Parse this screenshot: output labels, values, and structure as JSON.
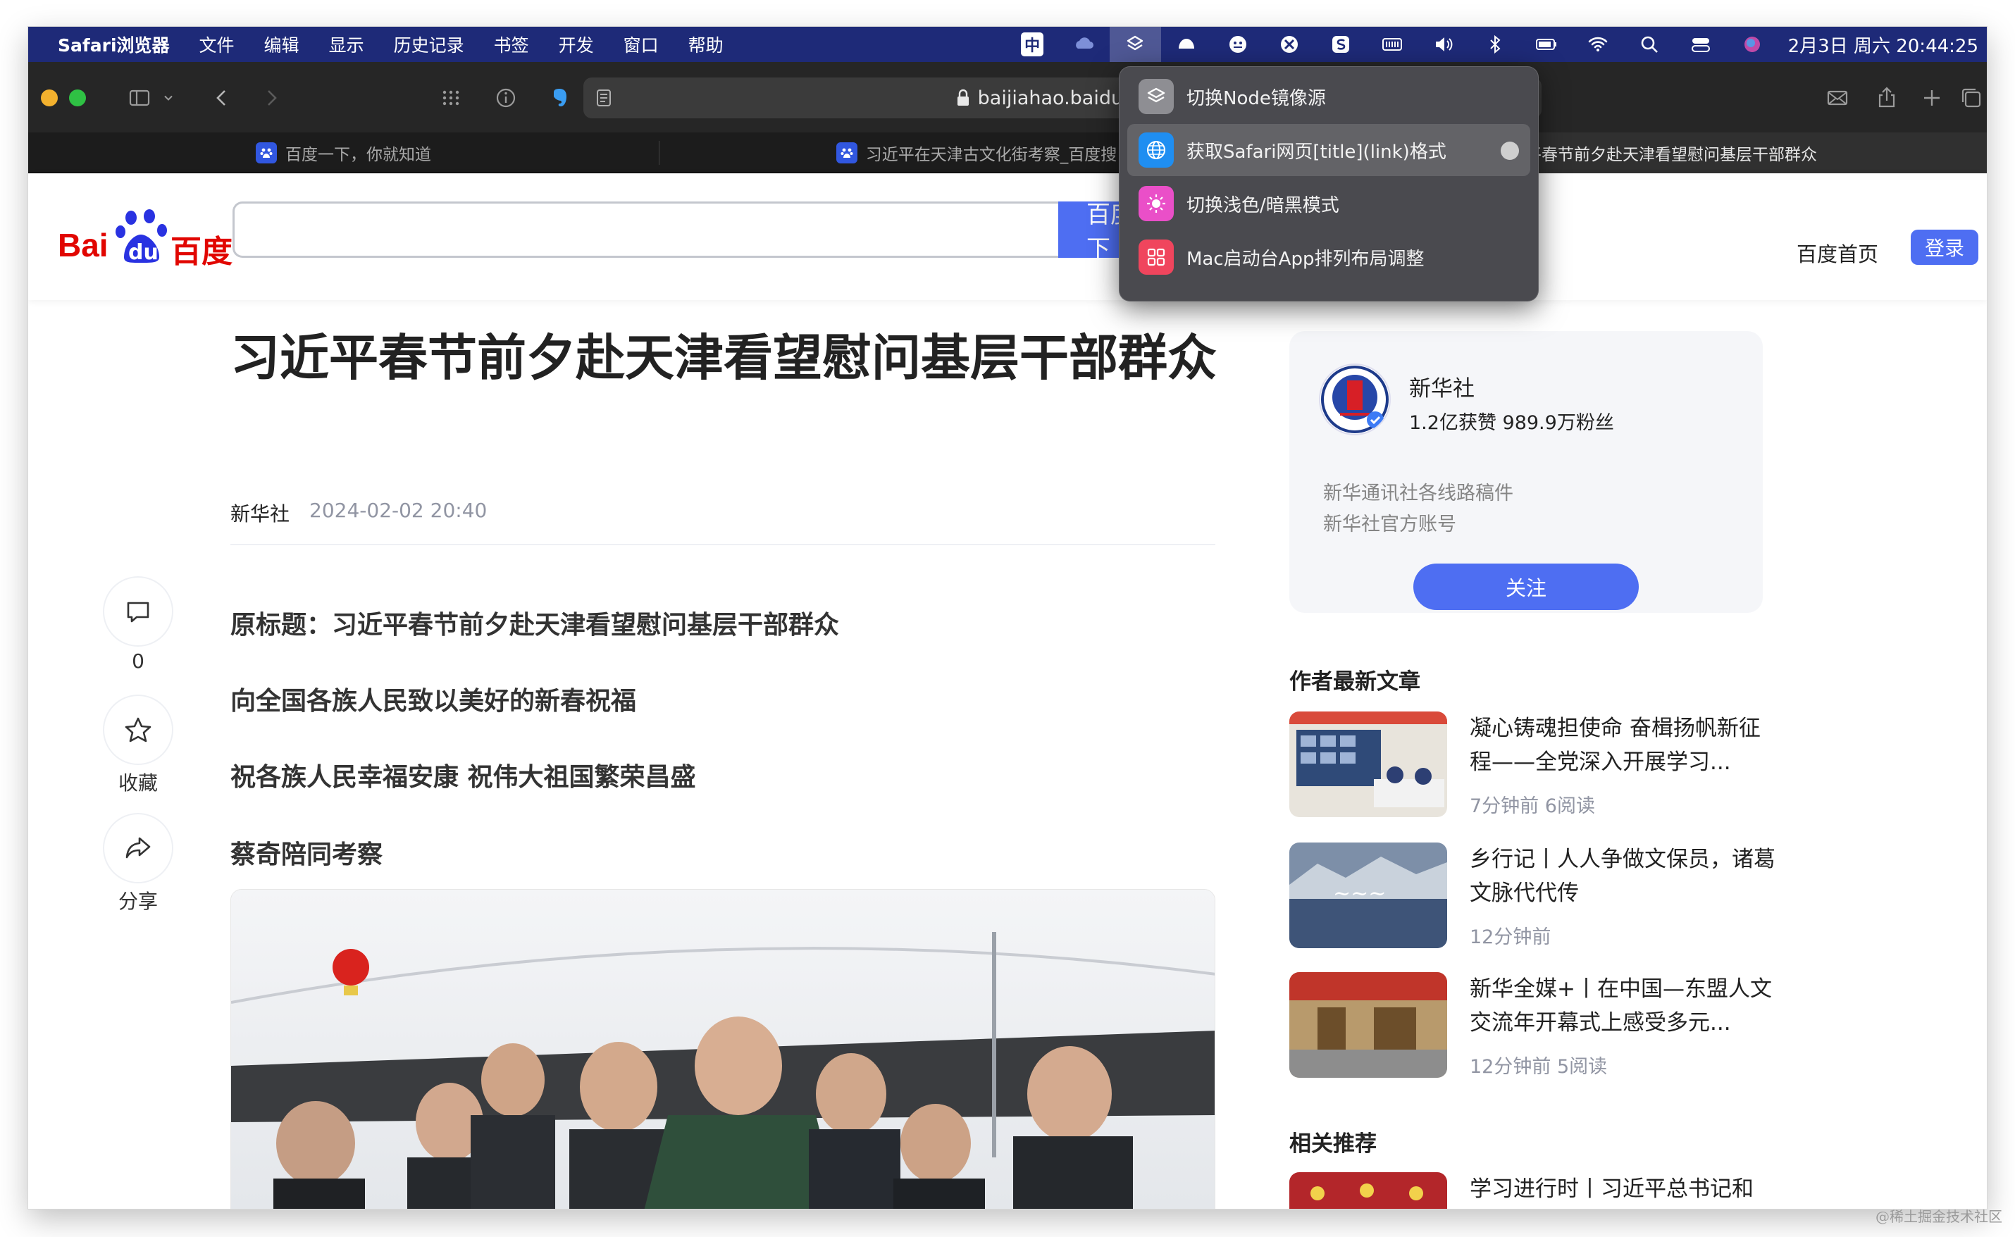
{
  "menubar": {
    "app": "Safari浏览器",
    "items": [
      "文件",
      "编辑",
      "显示",
      "历史记录",
      "书签",
      "开发",
      "窗口",
      "帮助"
    ],
    "status_icons": [
      "input-method-icon",
      "cloud-icon",
      "shortcuts-icon",
      "app-icon",
      "vpn-icon",
      "xcode-icon",
      "sogou-icon",
      "battery-meter-icon",
      "volume-icon",
      "bluetooth-icon",
      "battery-icon",
      "wifi-icon",
      "spotlight-icon",
      "control-center-icon",
      "siri-icon"
    ],
    "input_method": "中",
    "clock": "2月3日 周六  20:44:25"
  },
  "toolbar": {
    "url": "baijiahao.baidu.com"
  },
  "tabs": [
    {
      "title": "百度一下，你就知道",
      "active": false
    },
    {
      "title": "习近平在天津古文化街考察_百度搜",
      "active": false
    },
    {
      "title": "习近平春节前夕赴天津看望慰问基层干部群众",
      "active": true
    }
  ],
  "shortcuts_menu": {
    "items": [
      {
        "label": "切换Node镜像源",
        "icon": "layers-icon",
        "color": "#8e8e93"
      },
      {
        "label": "获取Safari网页[title](link)格式",
        "icon": "globe-icon",
        "color": "#1f8ef1"
      },
      {
        "label": "切换浅色/暗黑模式",
        "icon": "brightness-icon",
        "color": "#ea4fc8"
      },
      {
        "label": "Mac启动台App排列布局调整",
        "icon": "grid-icon",
        "color": "#f0455d"
      }
    ]
  },
  "baidu": {
    "logo_text_left": "Bai",
    "logo_text_mid": "du",
    "logo_text_right": "百度",
    "search_button": "百度一下",
    "home_link": "百度首页",
    "login_button": "登录"
  },
  "article": {
    "title": "习近平春节前夕赴天津看望慰问基层干部群众",
    "author": "新华社",
    "date": "2024-02-02 20:40",
    "paragraphs": [
      "原标题：习近平春节前夕赴天津看望慰问基层干部群众",
      "向全国各族人民致以美好的新春祝福",
      "祝各族人民幸福安康 祝伟大祖国繁荣昌盛",
      "蔡奇陪同考察"
    ]
  },
  "side_actions": {
    "comment_count": "0",
    "favorite_label": "收藏",
    "share_label": "分享"
  },
  "author_card": {
    "name": "新华社",
    "stats": "1.2亿获赞 989.9万粉丝",
    "desc1": "新华通讯社各线路稿件",
    "desc2": "新华社官方账号",
    "follow": "关注"
  },
  "latest_articles": {
    "heading": "作者最新文章",
    "items": [
      {
        "title": "凝心铸魂担使命 奋楫扬帆新征程——全党深入开展学习...",
        "meta": "7分钟前   6阅读"
      },
      {
        "title": "乡行记丨人人争做文保员，诸葛文脉代代传",
        "meta": "12分钟前"
      },
      {
        "title": "新华全媒+丨在中国—东盟人文交流年开幕式上感受多元...",
        "meta": "12分钟前   5阅读"
      }
    ]
  },
  "related": {
    "heading": "相关推荐",
    "items": [
      {
        "title": "学习进行时丨习近平总书记和"
      }
    ]
  },
  "watermark": "@稀土掘金技术社区"
}
